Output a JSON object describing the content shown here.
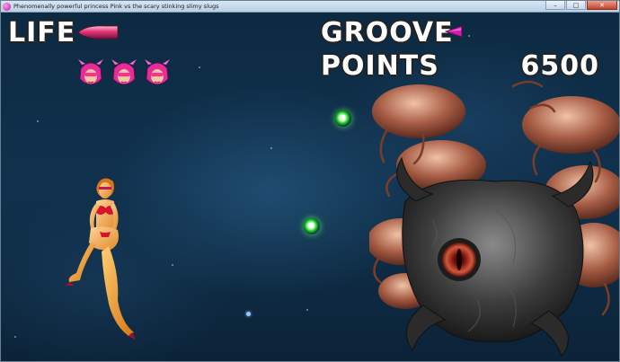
{
  "window": {
    "title": "Phenomenally powerful princess Pink vs the scary stinking slimy slugs",
    "minimize_glyph": "–",
    "maximize_glyph": "□",
    "close_glyph": "✕"
  },
  "hud": {
    "life_label": "LIFE",
    "groove_label": "GROOVE",
    "points_label": "POINTS",
    "score": "6500",
    "lives_remaining": 3,
    "life_level": 0.9,
    "groove_level": 0.4
  },
  "colors": {
    "life_bar": "#e0377a",
    "groove_bar": "#cc1fa8",
    "orb": "#22d12b",
    "hud_text": "#ffffff"
  },
  "icons": [
    "app-icon",
    "pink-head-life-icon",
    "green-orb",
    "boss-slug-cluster",
    "princess-pink-sprite"
  ]
}
